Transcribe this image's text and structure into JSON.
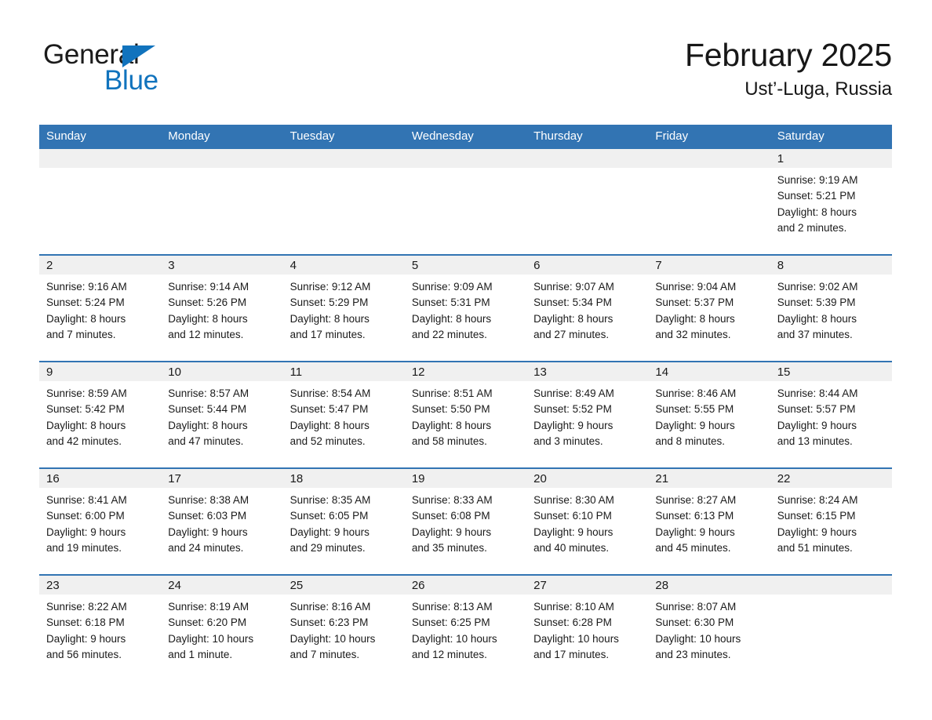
{
  "brand": {
    "name_part1": "General",
    "name_part2": "Blue",
    "triangle_color": "#1173bd",
    "text_color": "#1b1b1b"
  },
  "header": {
    "title": "February 2025",
    "subtitle": "Ust’-Luga, Russia"
  },
  "theme": {
    "header_blue": "#3274b3",
    "daynum_strip": "#f0f0f0",
    "text": "#1a1a1a",
    "page_bg": "#ffffff"
  },
  "calendar": {
    "day_headers": [
      "Sunday",
      "Monday",
      "Tuesday",
      "Wednesday",
      "Thursday",
      "Friday",
      "Saturday"
    ],
    "weeks": [
      [
        {
          "day": "",
          "lines": []
        },
        {
          "day": "",
          "lines": []
        },
        {
          "day": "",
          "lines": []
        },
        {
          "day": "",
          "lines": []
        },
        {
          "day": "",
          "lines": []
        },
        {
          "day": "",
          "lines": []
        },
        {
          "day": "1",
          "lines": [
            "Sunrise: 9:19 AM",
            "Sunset: 5:21 PM",
            "Daylight: 8 hours",
            "and 2 minutes."
          ]
        }
      ],
      [
        {
          "day": "2",
          "lines": [
            "Sunrise: 9:16 AM",
            "Sunset: 5:24 PM",
            "Daylight: 8 hours",
            "and 7 minutes."
          ]
        },
        {
          "day": "3",
          "lines": [
            "Sunrise: 9:14 AM",
            "Sunset: 5:26 PM",
            "Daylight: 8 hours",
            "and 12 minutes."
          ]
        },
        {
          "day": "4",
          "lines": [
            "Sunrise: 9:12 AM",
            "Sunset: 5:29 PM",
            "Daylight: 8 hours",
            "and 17 minutes."
          ]
        },
        {
          "day": "5",
          "lines": [
            "Sunrise: 9:09 AM",
            "Sunset: 5:31 PM",
            "Daylight: 8 hours",
            "and 22 minutes."
          ]
        },
        {
          "day": "6",
          "lines": [
            "Sunrise: 9:07 AM",
            "Sunset: 5:34 PM",
            "Daylight: 8 hours",
            "and 27 minutes."
          ]
        },
        {
          "day": "7",
          "lines": [
            "Sunrise: 9:04 AM",
            "Sunset: 5:37 PM",
            "Daylight: 8 hours",
            "and 32 minutes."
          ]
        },
        {
          "day": "8",
          "lines": [
            "Sunrise: 9:02 AM",
            "Sunset: 5:39 PM",
            "Daylight: 8 hours",
            "and 37 minutes."
          ]
        }
      ],
      [
        {
          "day": "9",
          "lines": [
            "Sunrise: 8:59 AM",
            "Sunset: 5:42 PM",
            "Daylight: 8 hours",
            "and 42 minutes."
          ]
        },
        {
          "day": "10",
          "lines": [
            "Sunrise: 8:57 AM",
            "Sunset: 5:44 PM",
            "Daylight: 8 hours",
            "and 47 minutes."
          ]
        },
        {
          "day": "11",
          "lines": [
            "Sunrise: 8:54 AM",
            "Sunset: 5:47 PM",
            "Daylight: 8 hours",
            "and 52 minutes."
          ]
        },
        {
          "day": "12",
          "lines": [
            "Sunrise: 8:51 AM",
            "Sunset: 5:50 PM",
            "Daylight: 8 hours",
            "and 58 minutes."
          ]
        },
        {
          "day": "13",
          "lines": [
            "Sunrise: 8:49 AM",
            "Sunset: 5:52 PM",
            "Daylight: 9 hours",
            "and 3 minutes."
          ]
        },
        {
          "day": "14",
          "lines": [
            "Sunrise: 8:46 AM",
            "Sunset: 5:55 PM",
            "Daylight: 9 hours",
            "and 8 minutes."
          ]
        },
        {
          "day": "15",
          "lines": [
            "Sunrise: 8:44 AM",
            "Sunset: 5:57 PM",
            "Daylight: 9 hours",
            "and 13 minutes."
          ]
        }
      ],
      [
        {
          "day": "16",
          "lines": [
            "Sunrise: 8:41 AM",
            "Sunset: 6:00 PM",
            "Daylight: 9 hours",
            "and 19 minutes."
          ]
        },
        {
          "day": "17",
          "lines": [
            "Sunrise: 8:38 AM",
            "Sunset: 6:03 PM",
            "Daylight: 9 hours",
            "and 24 minutes."
          ]
        },
        {
          "day": "18",
          "lines": [
            "Sunrise: 8:35 AM",
            "Sunset: 6:05 PM",
            "Daylight: 9 hours",
            "and 29 minutes."
          ]
        },
        {
          "day": "19",
          "lines": [
            "Sunrise: 8:33 AM",
            "Sunset: 6:08 PM",
            "Daylight: 9 hours",
            "and 35 minutes."
          ]
        },
        {
          "day": "20",
          "lines": [
            "Sunrise: 8:30 AM",
            "Sunset: 6:10 PM",
            "Daylight: 9 hours",
            "and 40 minutes."
          ]
        },
        {
          "day": "21",
          "lines": [
            "Sunrise: 8:27 AM",
            "Sunset: 6:13 PM",
            "Daylight: 9 hours",
            "and 45 minutes."
          ]
        },
        {
          "day": "22",
          "lines": [
            "Sunrise: 8:24 AM",
            "Sunset: 6:15 PM",
            "Daylight: 9 hours",
            "and 51 minutes."
          ]
        }
      ],
      [
        {
          "day": "23",
          "lines": [
            "Sunrise: 8:22 AM",
            "Sunset: 6:18 PM",
            "Daylight: 9 hours",
            "and 56 minutes."
          ]
        },
        {
          "day": "24",
          "lines": [
            "Sunrise: 8:19 AM",
            "Sunset: 6:20 PM",
            "Daylight: 10 hours",
            "and 1 minute."
          ]
        },
        {
          "day": "25",
          "lines": [
            "Sunrise: 8:16 AM",
            "Sunset: 6:23 PM",
            "Daylight: 10 hours",
            "and 7 minutes."
          ]
        },
        {
          "day": "26",
          "lines": [
            "Sunrise: 8:13 AM",
            "Sunset: 6:25 PM",
            "Daylight: 10 hours",
            "and 12 minutes."
          ]
        },
        {
          "day": "27",
          "lines": [
            "Sunrise: 8:10 AM",
            "Sunset: 6:28 PM",
            "Daylight: 10 hours",
            "and 17 minutes."
          ]
        },
        {
          "day": "28",
          "lines": [
            "Sunrise: 8:07 AM",
            "Sunset: 6:30 PM",
            "Daylight: 10 hours",
            "and 23 minutes."
          ]
        },
        {
          "day": "",
          "lines": []
        }
      ]
    ]
  }
}
